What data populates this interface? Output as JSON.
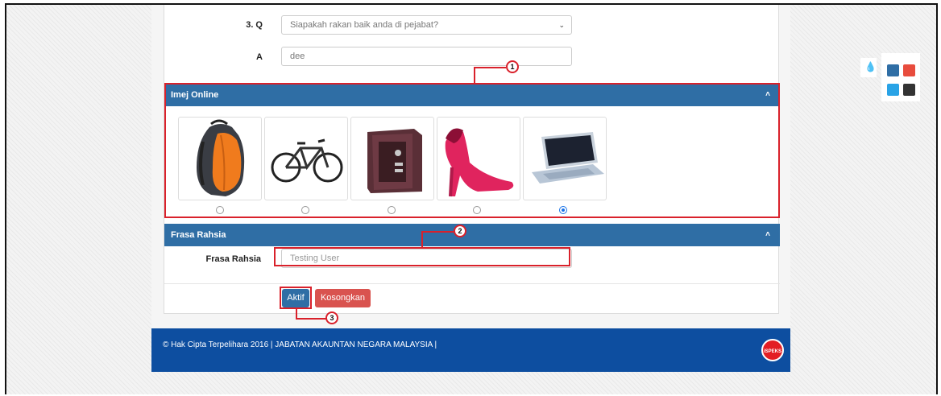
{
  "form": {
    "question_label": "3. Q",
    "question_value": "Siapakah rakan baik anda di pejabat?",
    "answer_label": "A",
    "answer_value": "dee"
  },
  "imej_panel": {
    "title": "Imej Online",
    "items": [
      {
        "icon": "backpack-image",
        "selected": false
      },
      {
        "icon": "bicycle-image",
        "selected": false
      },
      {
        "icon": "safe-image",
        "selected": false
      },
      {
        "icon": "high-heel-shoe-image",
        "selected": false
      },
      {
        "icon": "laptop-image",
        "selected": true
      }
    ]
  },
  "frasa_panel": {
    "title": "Frasa Rahsia",
    "field_label": "Frasa Rahsia",
    "field_placeholder": "Testing User"
  },
  "buttons": {
    "activate": "Aktif",
    "clear": "Kosongkan"
  },
  "callouts": [
    "1",
    "2",
    "3"
  ],
  "footer": {
    "copyright": "© Hak Cipta Terpelihara 2016 | JABATAN AKAUNTAN NEGARA MALAYSIA |",
    "logo_text": "iSPEKS"
  },
  "colors": {
    "panel_header": "#2f6ea5",
    "footer": "#0d4ea0",
    "button_primary": "#2f6ea5",
    "button_danger": "#d9534f",
    "annotation": "#d9212b",
    "theme_swatches": [
      "#2f6ea5",
      "#e84c3d",
      "#29a3e6",
      "#333333"
    ]
  }
}
